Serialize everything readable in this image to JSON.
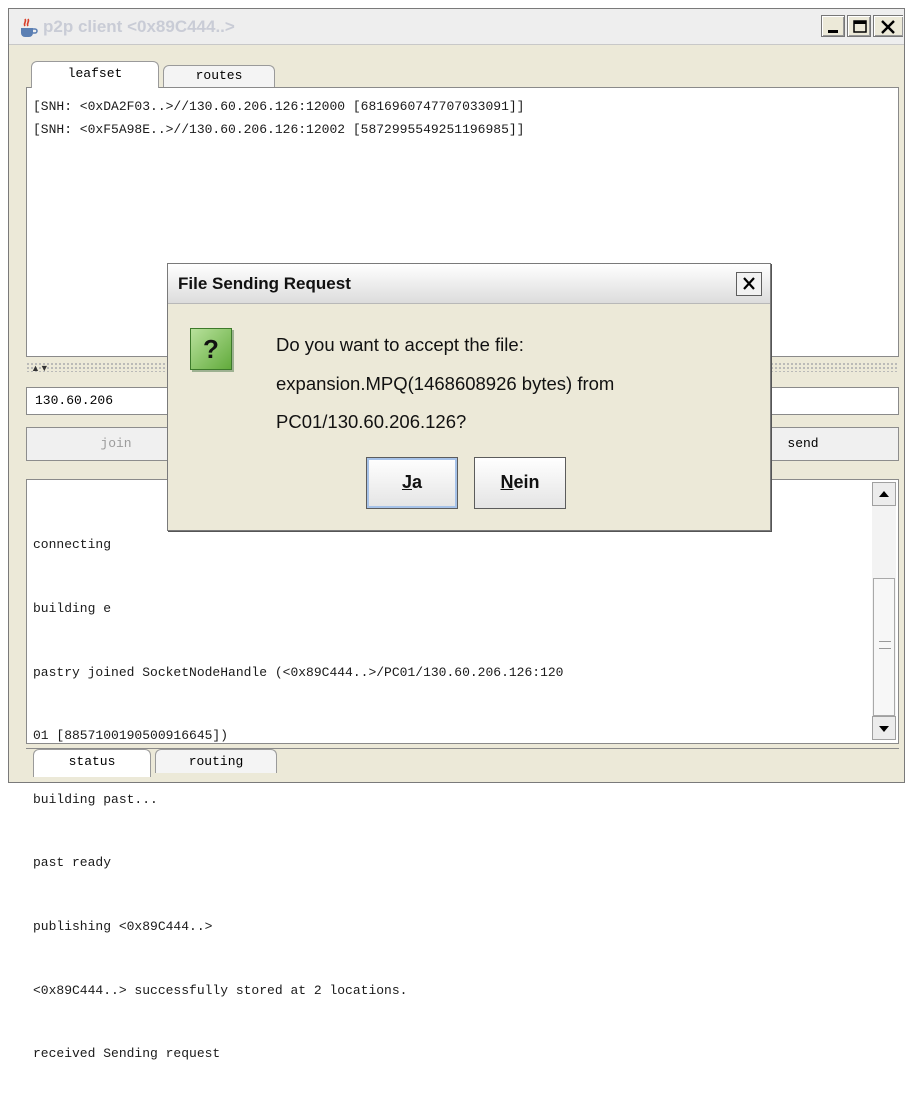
{
  "window": {
    "title": "p2p client <0x89C444..>",
    "min_glyph": "_",
    "max_glyph": "□",
    "close_glyph": "X"
  },
  "top_tabs": [
    {
      "label": "leafset",
      "active": true
    },
    {
      "label": "routes",
      "active": false
    }
  ],
  "leafset": {
    "lines": [
      "[SNH: <0xDA2F03..>//130.60.206.126:12000 [6816960747707033091]]",
      "[SNH: <0xF5A98E..>//130.60.206.126:12002 [5872995549251196985]]"
    ]
  },
  "address_field": {
    "value": "130.60.206"
  },
  "buttons": {
    "join": "join",
    "send": "send"
  },
  "status": {
    "lines": [
      "connecting",
      "building e",
      "pastry joined SocketNodeHandle (<0x89C444..>/PC01/130.60.206.126:120",
      "01 [8857100190500916645])",
      "building past...",
      "past ready",
      "publishing <0x89C444..>",
      "<0x89C444..> successfully stored at 2 locations.",
      "received Sending request"
    ]
  },
  "bottom_tabs": [
    {
      "label": "status",
      "active": true
    },
    {
      "label": "routing",
      "active": false
    }
  ],
  "dialog": {
    "title": "File Sending Request",
    "icon": "question-icon",
    "icon_glyph": "?",
    "message_lines": [
      "Do you want to accept the file:",
      "expansion.MPQ(1468608926 bytes) from",
      "PC01/130.60.206.126?"
    ],
    "yes_mnemonic": "J",
    "yes_rest": "a",
    "no_mnemonic": "N",
    "no_rest": "ein"
  }
}
